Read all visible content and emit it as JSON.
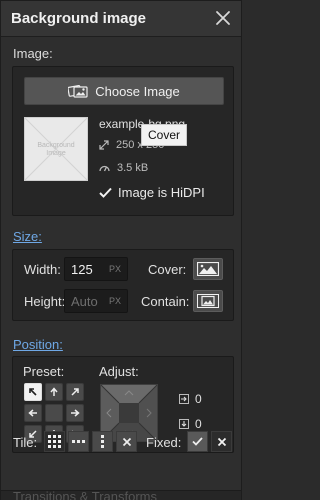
{
  "panel": {
    "title": "Background image"
  },
  "image": {
    "section_label": "Image:",
    "choose_label": "Choose Image",
    "thumb_text": "Background\nImage",
    "filename": "example-bg.png",
    "dimensions": "250 x 250",
    "filesize": "3.5 kB",
    "hidpi_label": "Image is HiDPI",
    "hidpi_checked": true,
    "tooltip": "Cover"
  },
  "size": {
    "section_label": "Size:",
    "width_label": "Width:",
    "width_value": "125",
    "width_unit": "PX",
    "height_label": "Height:",
    "height_placeholder": "Auto",
    "height_unit": "PX",
    "cover_label": "Cover:",
    "contain_label": "Contain:"
  },
  "position": {
    "section_label": "Position:",
    "preset_label": "Preset:",
    "adjust_label": "Adjust:",
    "offset_x": "0",
    "offset_y": "0",
    "active_preset": "top-left"
  },
  "tile": {
    "label": "Tile:",
    "options": [
      "tile-both",
      "tile-horizontal",
      "tile-vertical",
      "no-tile"
    ],
    "active": "tile-both"
  },
  "fixed": {
    "label": "Fixed:",
    "value": "off"
  },
  "footer": {
    "text": "Transitions & Transforms"
  }
}
